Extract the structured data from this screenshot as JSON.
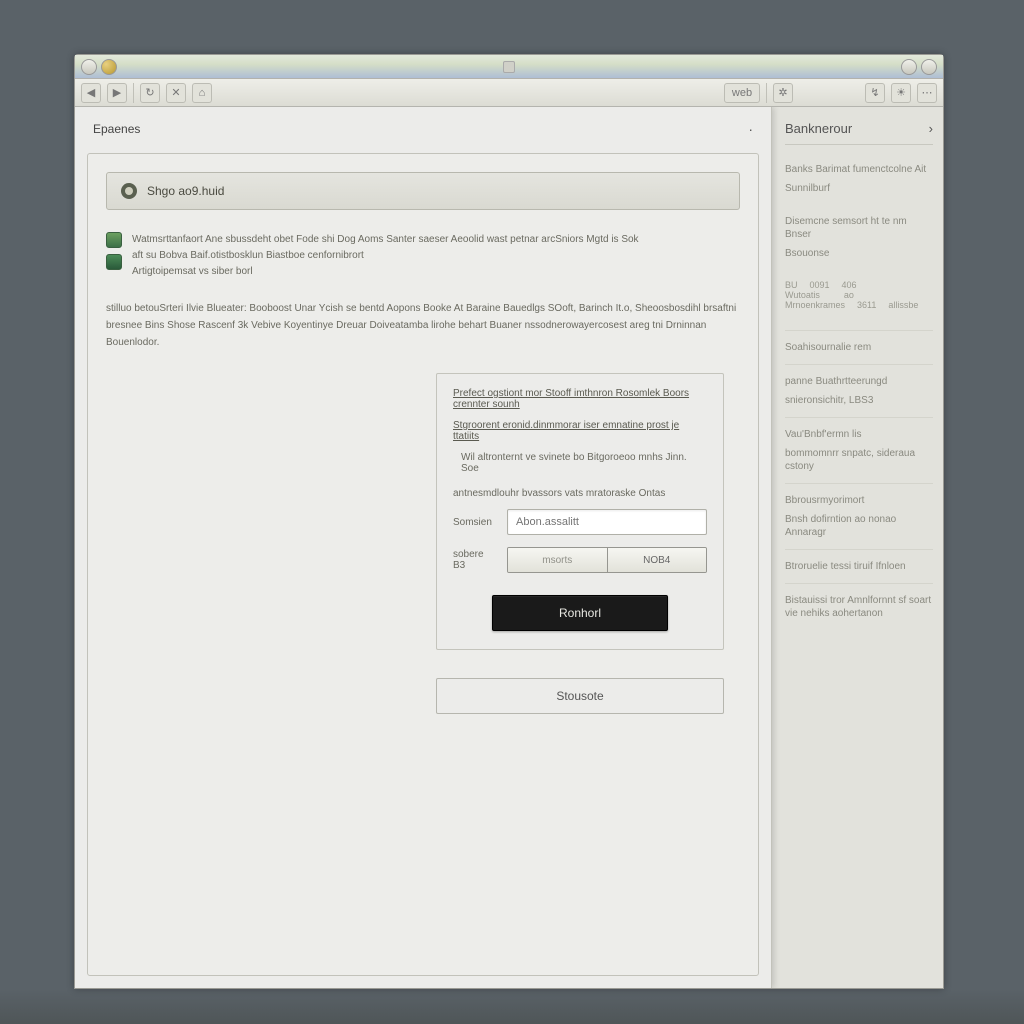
{
  "titlebar": {
    "center_mark": "·"
  },
  "toolbar": {
    "search_label": "web"
  },
  "right_panel": {
    "title": "Banknerour",
    "items": [
      "Banks Barimat fumenctcolne Ait",
      "Sunnilburf",
      "Disemcne semsort ht te nm Bnser",
      "Bsouonse"
    ],
    "table_rows": [
      [
        "BU",
        "0091",
        "406"
      ],
      [
        "Wutoatis",
        "",
        "ao"
      ],
      [
        "Mrnoenkrames",
        "3611",
        "allissbe"
      ]
    ],
    "more": [
      "Soahisournalie rem",
      "panne Buathrtteerungd",
      "snieronsichitr, LBS3",
      "Vau'Bnbf'ermn lis",
      "bommomnrr snpatc, sideraua cstony",
      "Bbrousrmyorimort",
      "Bnsh dofirntion ao nonao Annaragr",
      "Btroruelie tessi tiruif Ifnloen",
      "Bistauissi tror Amnlfornnt sf soart vie nehiks aohertanon"
    ]
  },
  "dialog": {
    "title": "Epaenes",
    "banner": "Shgo ao9.huid",
    "info_line1": "Watmsrttanfaort Ane sbussdeht obet Fode shi Dog Aoms Santer saeser Aeoolid wast petnar arcSniors Mgtd is Sok",
    "info_line2": "aft su Bobva Baif.otistbosklun Biastboe cenfornibrort",
    "info_line3": "Artigtoipemsat vs siber borl",
    "para": "stilluo betouSrteri Ilvie Blueater: Booboost Unar Ycish se bentd Aopons Booke At Baraine Bauedlgs SOoft, Barinch It.o, Sheoosbosdihl brsaftni bresnee Bins Shose Rascenf 3k Vebive Koyentinye Dreuar Doiveatamba lirohe behart Buaner nssodnerowayercosest areg tni Drninnan Bouenlodor.",
    "form": {
      "link1": "Prefect ogstiont mor Stooff imthnron Rosomlek Boors crennter sounh",
      "link2": "Stgroorent eronid.dinmmorar iser emnatine prost je ttatiits",
      "hint": "Wil altronternt ve svinete bo Bitgoroeoo mnhs Jinn. Soe",
      "header": "antnesmdlouhr bvassors vats mratoraske Ontas",
      "name_label": "Somsien",
      "name_placeholder": "Abon.assalitt",
      "save_label": "sobere B3",
      "seg_a": "msorts",
      "seg_b": "NOB4",
      "primary_button": "Ronhorl",
      "secondary_button": "Stousote"
    }
  }
}
